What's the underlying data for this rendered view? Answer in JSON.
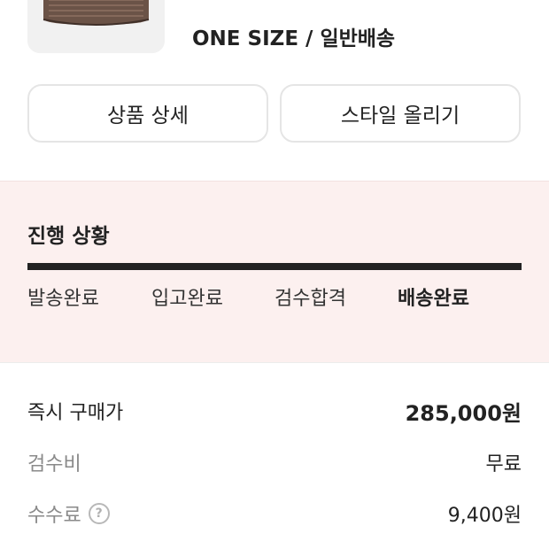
{
  "product": {
    "option_text": "ONE SIZE / 일반배송",
    "thumbnail_icon": "cap-image"
  },
  "actions": {
    "detail_label": "상품 상세",
    "style_label": "스타일 올리기"
  },
  "progress": {
    "title": "진행 상황",
    "completed_fraction": 1.0,
    "steps": [
      {
        "label": "발송완료",
        "active": false
      },
      {
        "label": "입고완료",
        "active": false
      },
      {
        "label": "검수합격",
        "active": false
      },
      {
        "label": "배송완료",
        "active": true
      }
    ]
  },
  "prices": {
    "buy_now": {
      "label": "즉시 구매가",
      "value": "285,000원"
    },
    "inspection_fee": {
      "label": "검수비",
      "value": "무료"
    },
    "commission": {
      "label": "수수료",
      "help_icon": "question-circle-icon",
      "help_glyph": "?",
      "value": "9,400원"
    }
  },
  "colors": {
    "progress_background": "#fcf0ef",
    "progress_fill": "#222222",
    "muted_text": "#8a8a8a"
  }
}
